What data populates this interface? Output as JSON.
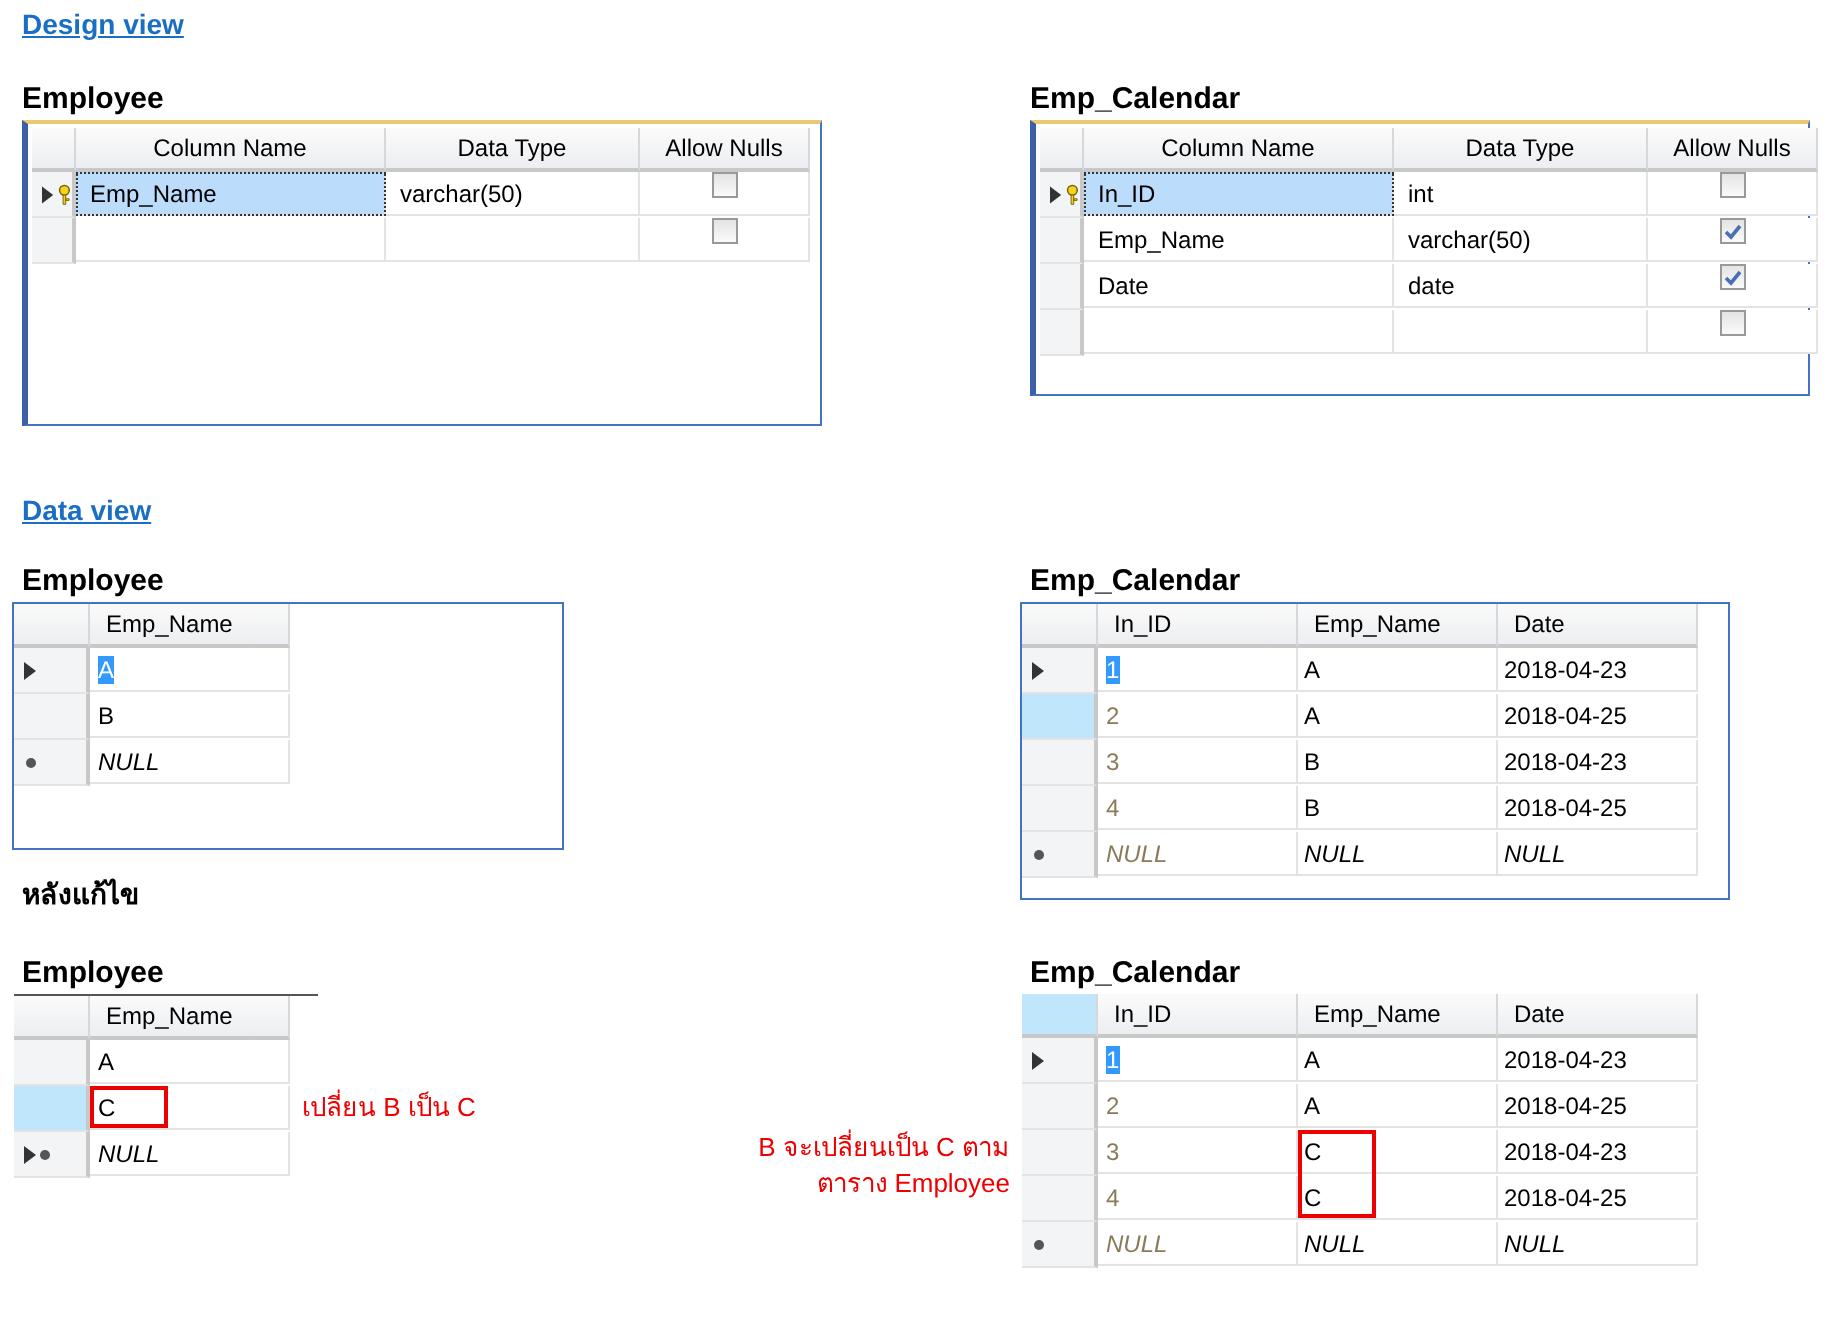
{
  "design_view": {
    "link": "Design view",
    "tables": [
      {
        "title": "Employee",
        "columns": [
          "Column Name",
          "Data Type",
          "Allow Nulls"
        ],
        "rows": [
          {
            "kind": "key",
            "column_name": "Emp_Name",
            "data_type": "varchar(50)",
            "allow_nulls": false,
            "selected": true
          },
          {
            "kind": "empty",
            "allow_nulls": false,
            "selected": false
          }
        ]
      },
      {
        "title": "Emp_Calendar",
        "columns": [
          "Column Name",
          "Data Type",
          "Allow Nulls"
        ],
        "rows": [
          {
            "kind": "key",
            "column_name": "In_ID",
            "data_type": "int",
            "allow_nulls": false,
            "selected": true
          },
          {
            "kind": "normal",
            "column_name": "Emp_Name",
            "data_type": "varchar(50)",
            "allow_nulls": true,
            "selected": false
          },
          {
            "kind": "normal",
            "column_name": "Date",
            "data_type": "date",
            "allow_nulls": true,
            "selected": false
          },
          {
            "kind": "empty",
            "allow_nulls": false,
            "selected": false
          }
        ]
      }
    ]
  },
  "data_view": {
    "link": "Data view",
    "tables": [
      {
        "title": "Employee",
        "columns": [
          {
            "name": "Emp_Name",
            "kind": "text"
          }
        ],
        "rows": [
          {
            "kind": "current",
            "selected": false,
            "editing": true,
            "cells": [
              {
                "text": "A",
                "marked": false
              }
            ]
          },
          {
            "kind": "normal",
            "selected": false,
            "editing": false,
            "cells": [
              {
                "text": "B",
                "marked": false
              }
            ]
          },
          {
            "kind": "new",
            "selected": false,
            "editing": false,
            "cells": [
              {
                "text": "NULL",
                "marked": false
              }
            ]
          }
        ]
      },
      {
        "title": "Emp_Calendar",
        "columns": [
          {
            "name": "In_ID",
            "kind": "identity"
          },
          {
            "name": "Emp_Name",
            "kind": "text"
          },
          {
            "name": "Date",
            "kind": "text"
          }
        ],
        "rows": [
          {
            "kind": "current",
            "selected": false,
            "editing": true,
            "cells": [
              {
                "text": "1",
                "marked": false
              },
              {
                "text": "A",
                "marked": false
              },
              {
                "text": "2018-04-23",
                "marked": false
              }
            ]
          },
          {
            "kind": "normal",
            "selected": true,
            "editing": false,
            "cells": [
              {
                "text": "2",
                "marked": false
              },
              {
                "text": "A",
                "marked": false
              },
              {
                "text": "2018-04-25",
                "marked": false
              }
            ]
          },
          {
            "kind": "normal",
            "selected": false,
            "editing": false,
            "cells": [
              {
                "text": "3",
                "marked": false
              },
              {
                "text": "B",
                "marked": false
              },
              {
                "text": "2018-04-23",
                "marked": false
              }
            ]
          },
          {
            "kind": "normal",
            "selected": false,
            "editing": false,
            "cells": [
              {
                "text": "4",
                "marked": false
              },
              {
                "text": "B",
                "marked": false
              },
              {
                "text": "2018-04-25",
                "marked": false
              }
            ]
          },
          {
            "kind": "new",
            "selected": false,
            "editing": false,
            "cells": [
              {
                "text": "NULL",
                "marked": false
              },
              {
                "text": "NULL",
                "marked": false
              },
              {
                "text": "NULL",
                "marked": false
              }
            ]
          }
        ]
      }
    ]
  },
  "after_edit": {
    "heading": "หลังแก้ไข",
    "tables": [
      {
        "title": "Employee",
        "note": "เปลี่ยน B เป็น C",
        "columns": [
          {
            "name": "Emp_Name",
            "kind": "text"
          }
        ],
        "rows": [
          {
            "kind": "normal",
            "selected": false,
            "editing": false,
            "cells": [
              {
                "text": "A",
                "marked": false
              }
            ]
          },
          {
            "kind": "normal",
            "selected": true,
            "editing": false,
            "cells": [
              {
                "text": "C",
                "marked": true
              }
            ]
          },
          {
            "kind": "current_new",
            "selected": false,
            "editing": false,
            "cells": [
              {
                "text": "NULL",
                "marked": false
              }
            ]
          }
        ]
      },
      {
        "title": "Emp_Calendar",
        "note": "B จะเปลี่ยนเป็น C ตาม ตาราง Employee",
        "corner_selected": true,
        "columns": [
          {
            "name": "In_ID",
            "kind": "identity"
          },
          {
            "name": "Emp_Name",
            "kind": "text"
          },
          {
            "name": "Date",
            "kind": "text"
          }
        ],
        "rows": [
          {
            "kind": "current",
            "selected": false,
            "editing": true,
            "cells": [
              {
                "text": "1",
                "marked": false
              },
              {
                "text": "A",
                "marked": false
              },
              {
                "text": "2018-04-23",
                "marked": false
              }
            ]
          },
          {
            "kind": "normal",
            "selected": false,
            "editing": false,
            "cells": [
              {
                "text": "2",
                "marked": false
              },
              {
                "text": "A",
                "marked": false
              },
              {
                "text": "2018-04-25",
                "marked": false
              }
            ]
          },
          {
            "kind": "normal",
            "selected": false,
            "editing": false,
            "cells": [
              {
                "text": "3",
                "marked": false
              },
              {
                "text": "C",
                "marked": true
              },
              {
                "text": "2018-04-23",
                "marked": false
              }
            ]
          },
          {
            "kind": "normal",
            "selected": false,
            "editing": false,
            "cells": [
              {
                "text": "4",
                "marked": false
              },
              {
                "text": "C",
                "marked": true
              },
              {
                "text": "2018-04-25",
                "marked": false
              }
            ]
          },
          {
            "kind": "new",
            "selected": false,
            "editing": false,
            "cells": [
              {
                "text": "NULL",
                "marked": false
              },
              {
                "text": "NULL",
                "marked": false
              },
              {
                "text": "NULL",
                "marked": false
              }
            ]
          }
        ]
      }
    ]
  }
}
